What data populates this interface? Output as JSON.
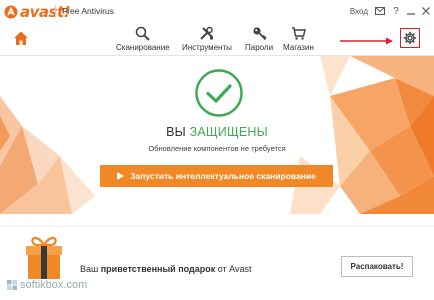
{
  "app": {
    "logo_text": "avast!",
    "product_name": "Free Antivirus"
  },
  "window_controls": {
    "login_label": "Вход",
    "items": [
      "mail-icon",
      "help-icon",
      "minimize-icon",
      "close-icon"
    ]
  },
  "nav": {
    "items": [
      {
        "label": "Сканирование",
        "icon": "search-icon"
      },
      {
        "label": "Инструменты",
        "icon": "tools-icon"
      },
      {
        "label": "Пароли",
        "icon": "key-icon"
      },
      {
        "label": "Магазин",
        "icon": "cart-icon"
      }
    ],
    "settings_icon": "gear-icon",
    "home_icon": "home-icon"
  },
  "status": {
    "title_prefix": "ВЫ ",
    "title_status": "ЗАЩИЩЕНЫ",
    "subtitle": "Обновление компонентов не требуется",
    "scan_button": "Запустить интеллектуальное сканирование"
  },
  "gift": {
    "text_prefix": "Ваш ",
    "text_bold": "приветственный подарок",
    "text_suffix": " от Avast",
    "button": "Распаковать!"
  },
  "watermark": {
    "text": "softikbox.com"
  },
  "colors": {
    "accent": "#f08826",
    "brand": "#ef6c1a",
    "ok_green": "#3daa55",
    "highlight_red": "#d9232a"
  }
}
